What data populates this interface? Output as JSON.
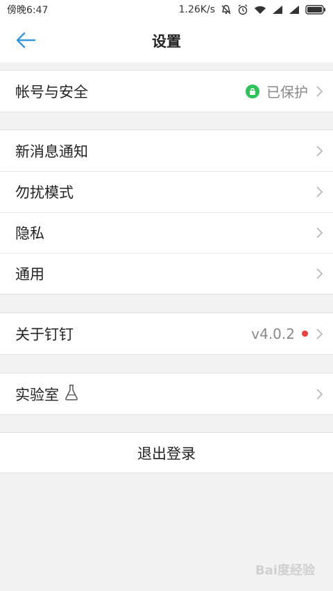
{
  "status_bar": {
    "time": "傍晚6:47",
    "network_speed": "1.26K/s",
    "icons": [
      "mute-icon",
      "alarm-icon",
      "wifi-icon",
      "signal-icon",
      "signal-icon",
      "battery-icon"
    ]
  },
  "header": {
    "title": "设置",
    "back_icon": "arrow-left-icon"
  },
  "groups": {
    "account": {
      "label": "帐号与安全",
      "value": "已保护",
      "badge_icon": "lock-icon"
    },
    "notify_label": "新消息通知",
    "dnd_label": "勿扰模式",
    "privacy_label": "隐私",
    "general_label": "通用",
    "about": {
      "label": "关于钉钉",
      "value": "v4.0.2"
    },
    "lab": {
      "label": "实验室",
      "icon": "flask-icon"
    }
  },
  "logout_label": "退出登录",
  "watermark": "Bai度经验",
  "colors": {
    "accent": "#3296dc",
    "protected_green": "#2fc25b",
    "update_dot": "#f04141",
    "background": "#f2f2f2"
  }
}
